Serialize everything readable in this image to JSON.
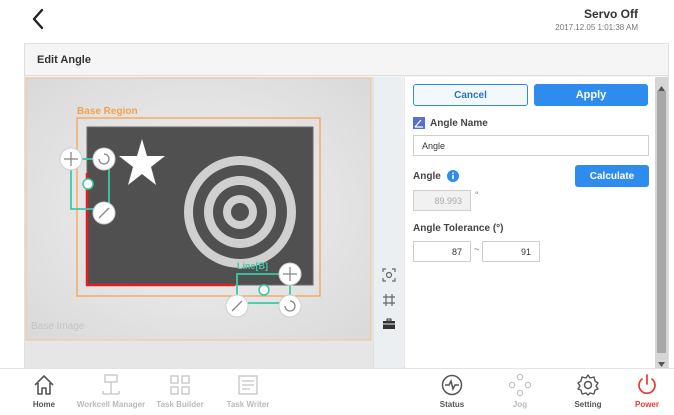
{
  "topbar": {
    "back_icon": "chevron-left-icon",
    "servo_status": "Servo Off",
    "timestamp": "2017.12.05 1:01:38 AM"
  },
  "panel": {
    "title": "Edit Angle"
  },
  "image": {
    "base_region_label": "Base Region",
    "line_label": "Line[B]",
    "base_image_label": "Base Image"
  },
  "form": {
    "cancel_label": "Cancel",
    "apply_label": "Apply",
    "angle_name_label": "Angle Name",
    "angle_name_value": "Angle",
    "angle_label": "Angle",
    "angle_value": "89.993",
    "angle_unit": "°",
    "calculate_label": "Calculate",
    "tolerance_label": "Angle Tolerance (°)",
    "tolerance_min": "87",
    "tolerance_sep": "~",
    "tolerance_max": "91"
  },
  "nav": {
    "items": [
      {
        "label": "Home",
        "icon": "home-icon"
      },
      {
        "label": "Workcell Manager",
        "icon": "workcell-icon"
      },
      {
        "label": "Task Builder",
        "icon": "task-builder-icon"
      },
      {
        "label": "Task Writer",
        "icon": "task-writer-icon"
      },
      {
        "label": "Status",
        "icon": "status-icon"
      },
      {
        "label": "Jog",
        "icon": "jog-icon"
      },
      {
        "label": "Setting",
        "icon": "gear-icon"
      },
      {
        "label": "Power",
        "icon": "power-icon"
      }
    ]
  },
  "colors": {
    "accent": "#2f8cef",
    "region_orange": "#f5a04a",
    "line_green": "#3cc9a8",
    "power_red": "#e53935"
  }
}
